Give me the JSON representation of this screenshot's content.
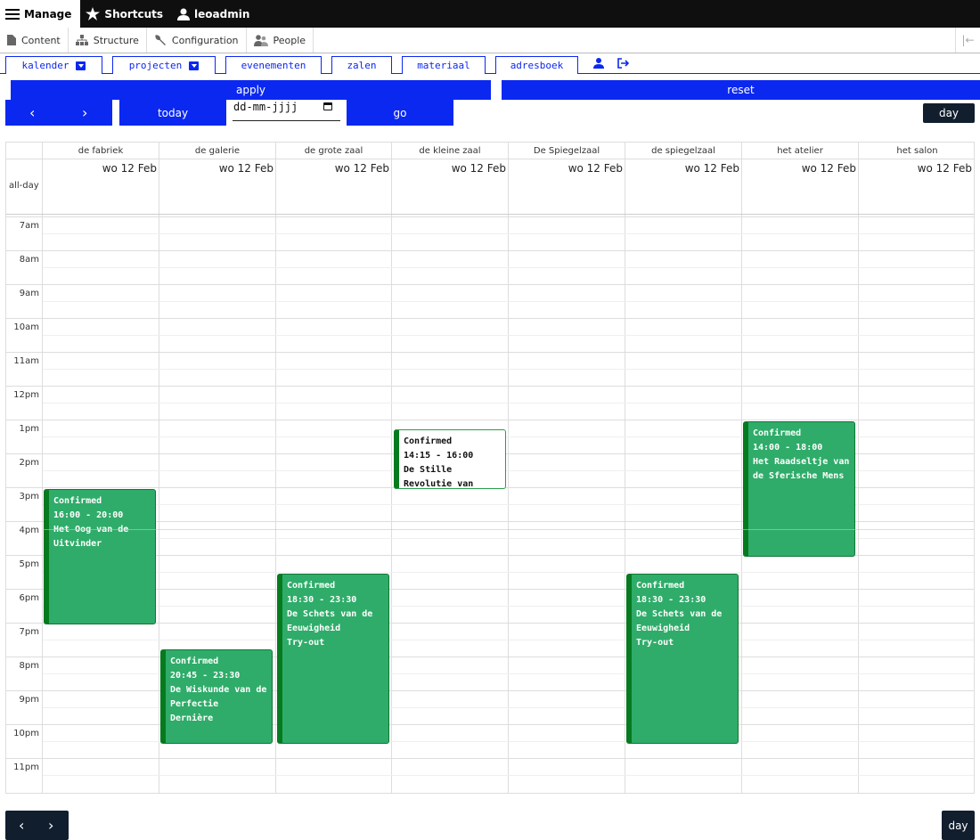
{
  "toolbar": {
    "manage": "Manage",
    "shortcuts": "Shortcuts",
    "user": "leoadmin"
  },
  "tray": {
    "content": "Content",
    "structure": "Structure",
    "configuration": "Configuration",
    "people": "People"
  },
  "sitenav": {
    "kalender": "kalender",
    "projecten": "projecten",
    "evenementen": "evenementen",
    "zalen": "zalen",
    "materiaal": "materiaal",
    "adresboek": "adresboek"
  },
  "filters": {
    "apply": "apply",
    "reset": "reset",
    "today": "today",
    "date_placeholder": "dd-mm-jjjj",
    "go": "go",
    "prev": "‹",
    "next": "›",
    "view": "day"
  },
  "calendar": {
    "allday_label": "all-day",
    "resources": [
      {
        "name": "de fabriek",
        "date": "wo 12 Feb"
      },
      {
        "name": "de galerie",
        "date": "wo 12 Feb"
      },
      {
        "name": "de grote zaal",
        "date": "wo 12 Feb"
      },
      {
        "name": "de kleine zaal",
        "date": "wo 12 Feb"
      },
      {
        "name": "De Spiegelzaal",
        "date": "wo 12 Feb"
      },
      {
        "name": "de spiegelzaal",
        "date": "wo 12 Feb"
      },
      {
        "name": "het atelier",
        "date": "wo 12 Feb"
      },
      {
        "name": "het salon",
        "date": "wo 12 Feb"
      }
    ],
    "hours": [
      "7am",
      "8am",
      "9am",
      "10am",
      "11am",
      "12pm",
      "1pm",
      "2pm",
      "3pm",
      "4pm",
      "5pm",
      "6pm",
      "7pm",
      "8pm",
      "9pm",
      "10pm",
      "11pm"
    ],
    "events": [
      {
        "status": "Confirmed",
        "time": "14:15 - 16:00",
        "title": "De Stille Revolutie van Leonardo",
        "extra": ""
      },
      {
        "status": "Confirmed",
        "time": "14:00 - 18:00",
        "title": "Het Raadseltje van de Sferische Mens",
        "extra": ""
      },
      {
        "status": "Confirmed",
        "time": "16:00 - 20:00",
        "title": "Het Oog van de Uitvinder",
        "extra": ""
      },
      {
        "status": "Confirmed",
        "time": "18:30 - 23:30",
        "title": "De Schets van de Eeuwigheid",
        "extra": "Try-out"
      },
      {
        "status": "Confirmed",
        "time": "18:30 - 23:30",
        "title": "De Schets van de Eeuwigheid",
        "extra": "Try-out"
      },
      {
        "status": "Confirmed",
        "time": "20:45 - 23:30",
        "title": "De Wiskunde van de Perfectie",
        "extra": "Dernière"
      }
    ]
  },
  "bottom": {
    "prev": "‹",
    "next": "›",
    "view": "day"
  }
}
